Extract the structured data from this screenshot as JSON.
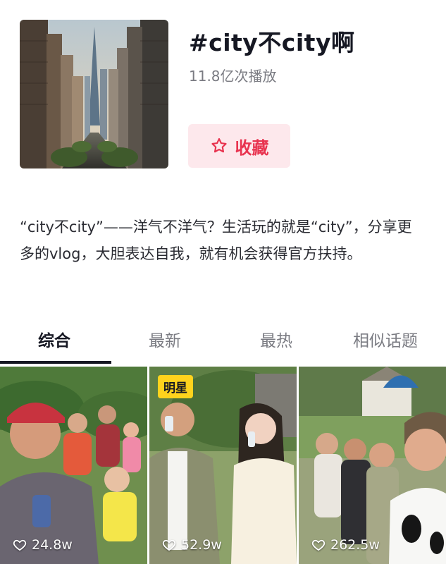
{
  "topic": {
    "title": "#city不city啊",
    "play_count": "11.8亿次播放",
    "favorite_label": "收藏",
    "description": "“city不city”——洋气不洋气？生活玩的就是“city”，分享更多的vlog，大胆表达自我，就有机会获得官方扶持。"
  },
  "tabs": [
    {
      "label": "综合",
      "active": true
    },
    {
      "label": "最新",
      "active": false
    },
    {
      "label": "最热",
      "active": false
    },
    {
      "label": "相似话题",
      "active": false
    }
  ],
  "videos": [
    {
      "likes": "24.8w",
      "badge": ""
    },
    {
      "likes": "52.9w",
      "badge": "明星"
    },
    {
      "likes": "262.5w",
      "badge": ""
    }
  ],
  "colors": {
    "accent": "#e8334f",
    "favorite_bg": "#fde8ec",
    "badge": "#ffd31d"
  },
  "icons": [
    "star-icon",
    "heart-icon"
  ]
}
